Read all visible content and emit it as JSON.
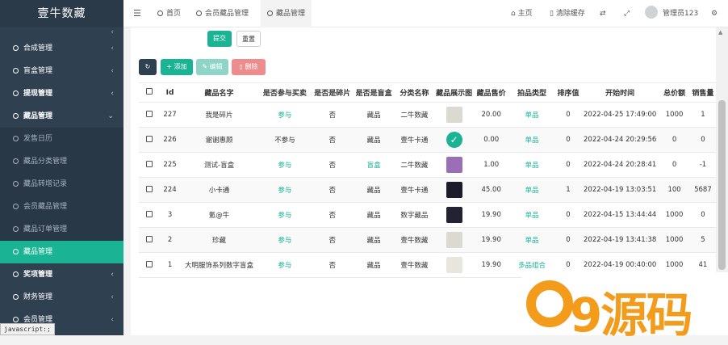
{
  "sidebar": {
    "logo": "壹牛数藏",
    "items": [
      {
        "label": "合成管理",
        "type": "top"
      },
      {
        "label": "盲盒管理",
        "type": "top"
      },
      {
        "label": "提现管理",
        "type": "top-bold"
      },
      {
        "label": "藏品管理",
        "type": "top-bold-open"
      },
      {
        "label": "发售日历",
        "type": "sub"
      },
      {
        "label": "藏品分类管理",
        "type": "sub"
      },
      {
        "label": "藏品转增记录",
        "type": "sub"
      },
      {
        "label": "会员藏品管理",
        "type": "sub"
      },
      {
        "label": "藏品订单管理",
        "type": "sub"
      },
      {
        "label": "藏品管理",
        "type": "active"
      },
      {
        "label": "奖项管理",
        "type": "top-bold"
      },
      {
        "label": "财务管理",
        "type": "top"
      },
      {
        "label": "会员管理",
        "type": "top"
      }
    ],
    "status": "javascript:;"
  },
  "topbar": {
    "menu_icon": "hamburger-icon",
    "tabs": [
      "首页",
      "会员藏品管理",
      "藏品管理"
    ],
    "home": "主页",
    "clear_cache": "清除缓存",
    "admin": "管理员123"
  },
  "toolbar": {
    "submit": "提交",
    "reset": "重置",
    "add": "添加",
    "edit": "编辑",
    "delete": "删除"
  },
  "table": {
    "columns": [
      "Id",
      "藏品名字",
      "是否参与买卖",
      "是否是碎片",
      "是否是盲盒",
      "分类名称",
      "藏品展示图",
      "藏品售价",
      "拍品类型",
      "排序值",
      "开始时间",
      "总价额",
      "销售量"
    ],
    "rows": [
      {
        "id": "227",
        "name": "我是碎片",
        "trade": "参与",
        "frag": "否",
        "box": "藏品",
        "cat": "二牛数藏",
        "price": "20.00",
        "type": "单品",
        "sort": "0",
        "time": "2022-04-25 17:49:00",
        "total": "1000",
        "sales": "1",
        "thumb": "#dcd8d2"
      },
      {
        "id": "226",
        "name": "谢谢惠顾",
        "trade": "不参与",
        "frag": "否",
        "box": "藏品",
        "cat": "壹牛卡通",
        "price": "0.00",
        "type": "单品",
        "sort": "0",
        "time": "2022-04-24 20:29:56",
        "total": "0",
        "sales": "0",
        "thumb": "#1ab394"
      },
      {
        "id": "225",
        "name": "测试-盲盒",
        "trade": "参与",
        "frag": "否",
        "box": "盲盒",
        "cat": "二牛数藏",
        "price": "1.00",
        "type": "单品",
        "sort": "0",
        "time": "2022-04-24 20:28:41",
        "total": "0",
        "sales": "-1",
        "thumb": "#9b6fb5"
      },
      {
        "id": "224",
        "name": "小卡通",
        "trade": "参与",
        "frag": "否",
        "box": "藏品",
        "cat": "壹牛卡通",
        "price": "45.00",
        "type": "单品",
        "sort": "1",
        "time": "2022-04-19 13:03:51",
        "total": "100",
        "sales": "5687",
        "thumb": "#1b1b2a"
      },
      {
        "id": "3",
        "name": "氪@牛",
        "trade": "参与",
        "frag": "否",
        "box": "藏品",
        "cat": "数字藏品",
        "price": "19.90",
        "type": "单品",
        "sort": "0",
        "time": "2022-04-15 13:44:44",
        "total": "1000",
        "sales": "0",
        "thumb": "#222233"
      },
      {
        "id": "2",
        "name": "珍藏",
        "trade": "参与",
        "frag": "否",
        "box": "藏品",
        "cat": "壹牛数藏",
        "price": "19.90",
        "type": "单品",
        "sort": "0",
        "time": "2022-04-19 13:41:38",
        "total": "1000",
        "sales": "5",
        "thumb": "#dcd8d2"
      },
      {
        "id": "1",
        "name": "大明服饰系列数字盲盒",
        "trade": "参与",
        "frag": "否",
        "box": "藏品",
        "cat": "壹牛数藏",
        "price": "19.90",
        "type": "多品组合",
        "sort": "0",
        "time": "2022-04-19 00:40:00",
        "total": "1000",
        "sales": "41",
        "thumb": "#e8e4de"
      }
    ]
  },
  "watermark": {
    "text": "9源码"
  },
  "colors": {
    "sidebar": "#2f4050",
    "accent": "#1ab394",
    "add": "#1ab394",
    "edit": "#8fd5c7",
    "delete": "#ed8c8c",
    "refresh": "#2f4050",
    "watermark": "#f39b1a"
  }
}
